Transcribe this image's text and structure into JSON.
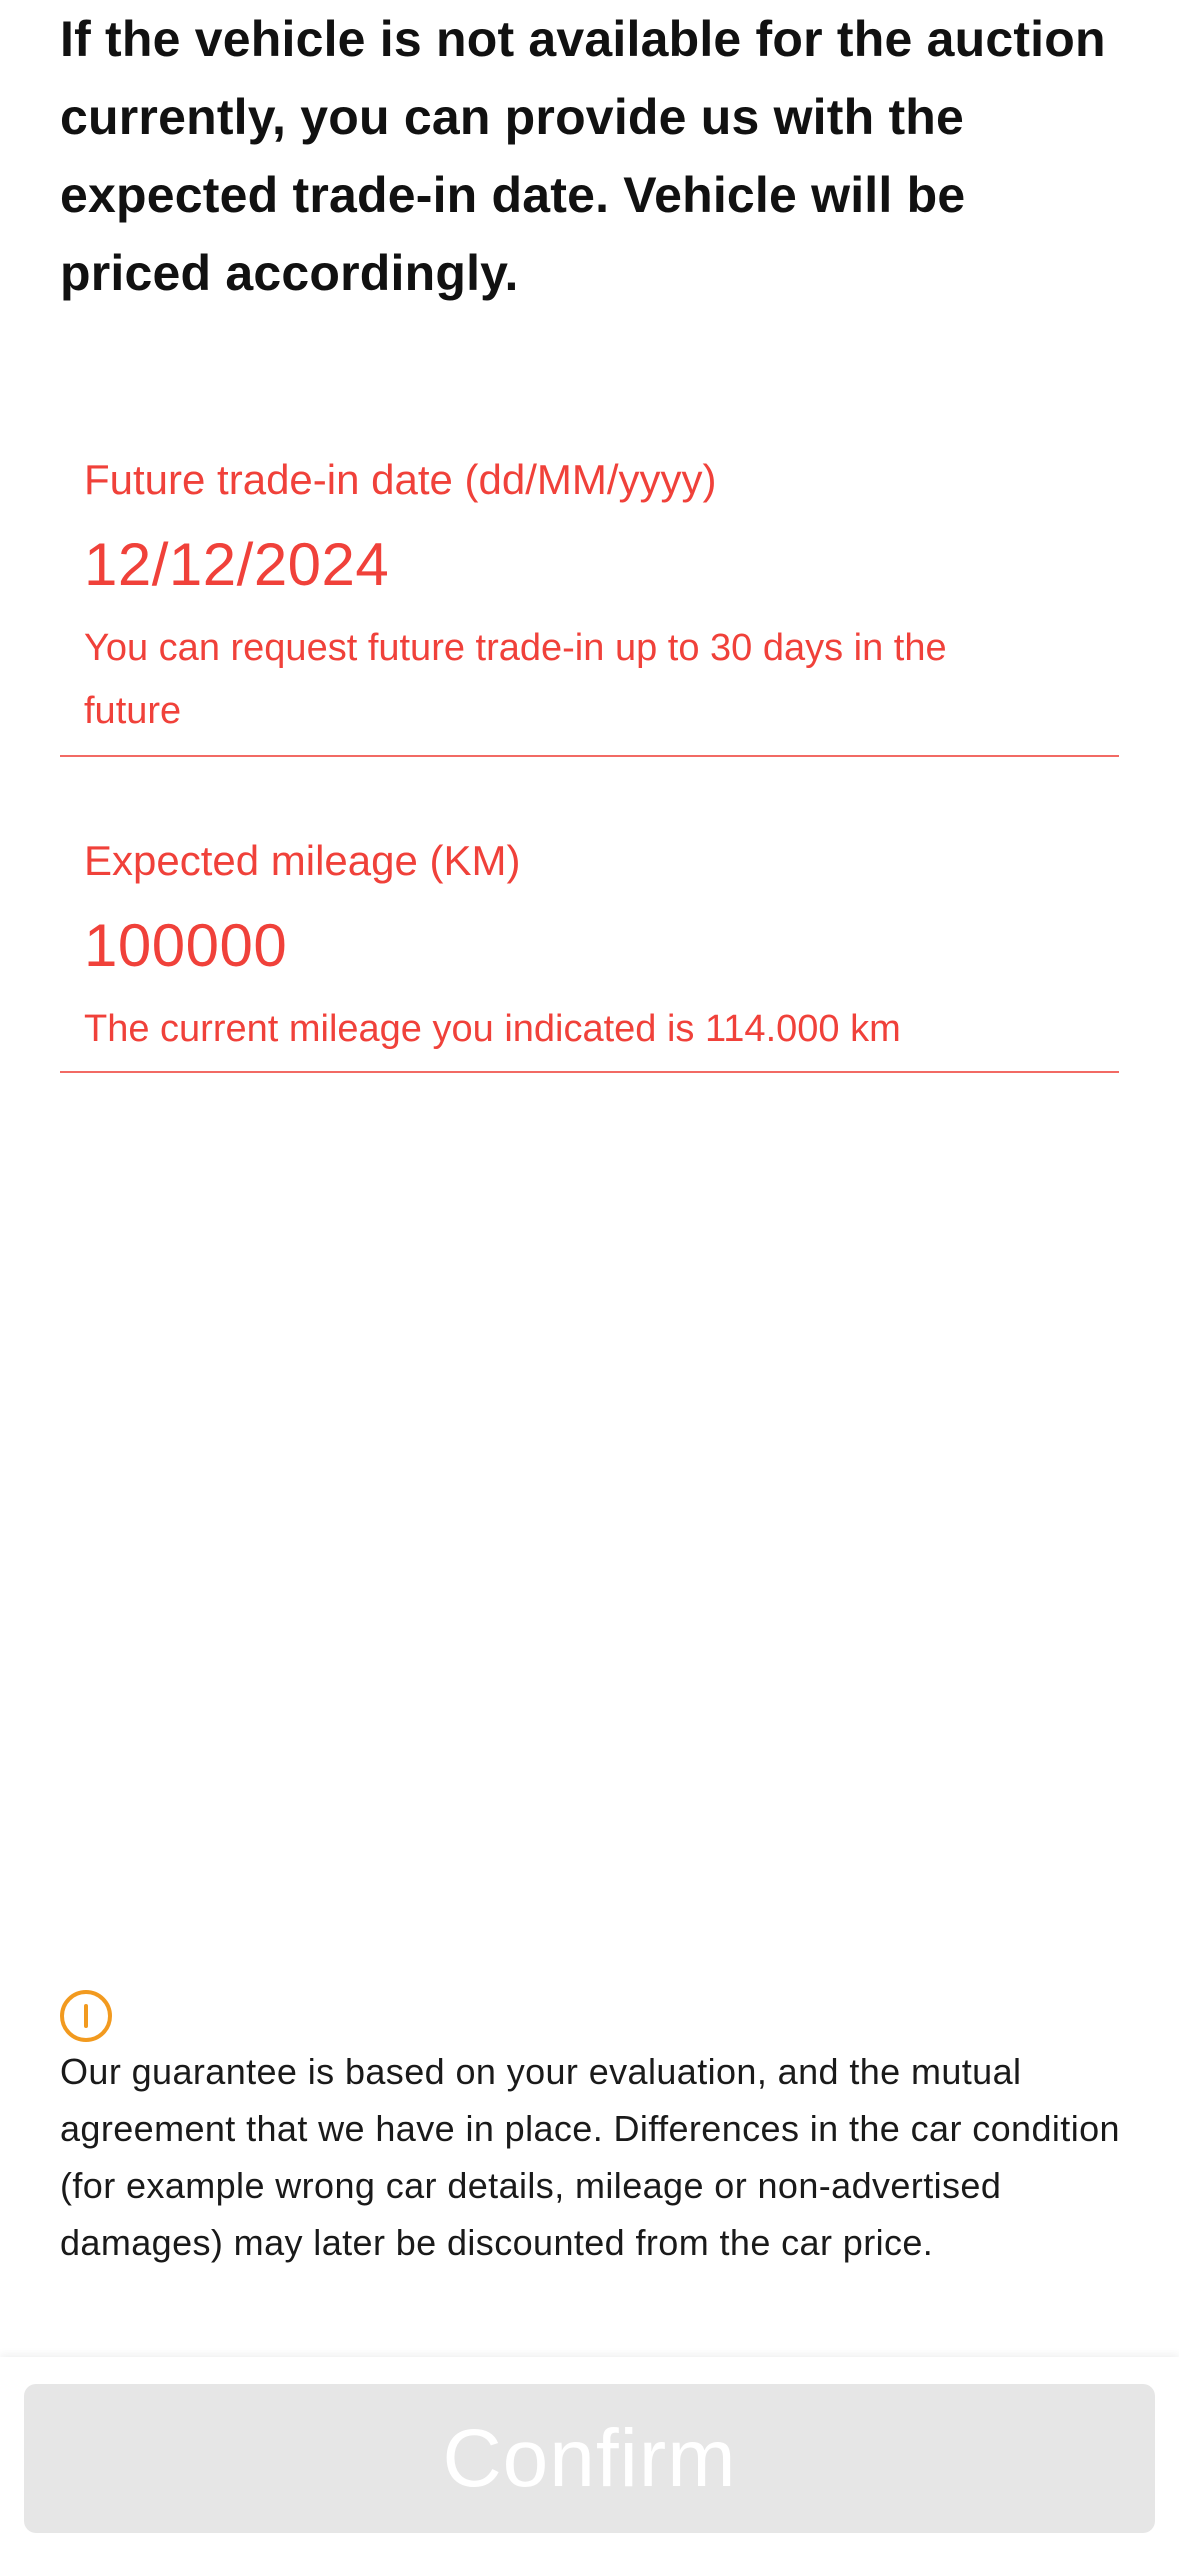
{
  "intro_text": "If the vehicle is not available for the auction currently, you can provide us with the expected trade-in date. Vehicle will be priced accordingly.",
  "trade_in_date": {
    "label": "Future trade-in date (dd/MM/yyyy)",
    "value": "12/12/2024",
    "error": "You can request future trade-in up to 30 days in the future"
  },
  "expected_mileage": {
    "label": "Expected mileage (KM)",
    "value": "100000",
    "error": "The current mileage you indicated is 114.000 km"
  },
  "notice": {
    "icon": "info-circle-icon",
    "text": "Our guarantee is based on your evaluation, and the mutual agreement that we have in place. Differences in the car condition (for example wrong car details, mileage or non-advertised damages) may later be discounted from the car price."
  },
  "confirm_label": "Confirm",
  "colors": {
    "error": "#f0413a",
    "notice_icon": "#f29a1f",
    "button_disabled_bg": "#e6e6e6"
  }
}
